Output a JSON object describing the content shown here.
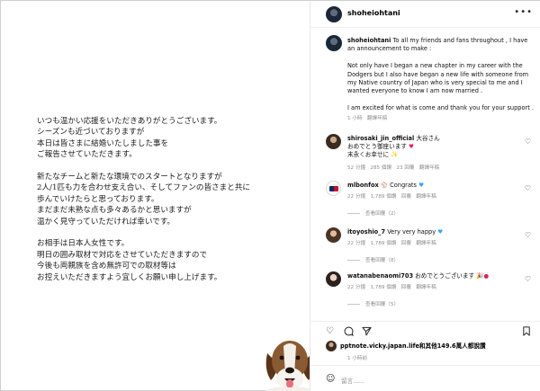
{
  "post": {
    "letter_paragraphs": [
      [
        "いつも温かい応援をいただきありがとうございます。",
        "シーズンも近づいておりますが",
        "本日は皆さまに結婚いたしました事を",
        "ご報告させていただきます。"
      ],
      [
        "新たなチームと新たな環境でのスタートとなりますが",
        "2人/1匹も力を合わせ支え合い、そしてファンの皆さまと共に",
        "歩んでいけたらと思っております。",
        "まだまだ未熟な点も多々あるかと思いますが",
        "温かく見守っていただければ幸いです。"
      ],
      [
        "お相手は日本人女性です。",
        "明日の囲み取材で対応をさせていただきますので",
        "今後も両親族を含め無許可での取材等は",
        "お控えいただきますよう宜しくお願い申し上げます。"
      ]
    ]
  },
  "header": {
    "username": "shoheiohtani",
    "more_icon": "more-horizontal-icon"
  },
  "caption": {
    "username": "shoheiohtani",
    "para1": "To all my friends and fans throughout , I have an announcement to make :",
    "para2": "Not only have I began a new chapter in my career with the Dodgers but I also have began a new life with someone from my Native country of Japan who is very special to me and I wanted everyone to know I am now married .",
    "para3": "I am excited for what is come and thank you for your support .",
    "time": "1 小時",
    "translate": "翻譯年稿"
  },
  "comments": [
    {
      "username": "shirosaki_jin_official",
      "text": "大谷さん おめでとう御座います 末永くお幸せに",
      "text_line1": "大谷さん",
      "text_line2": "おめでとう御座います",
      "text_line3": "末永くお幸せに",
      "time": "52 分鐘",
      "likes": "285 個讚",
      "reply": "23 回覆",
      "translate": "翻譯年稿"
    },
    {
      "username": "mlbonfox",
      "text": "Congrats",
      "time": "22 分鐘",
      "likes": "1,789 個讚",
      "reply": "回覆",
      "translate": "翻譯年稿",
      "view_replies": "查看回覆（2）"
    },
    {
      "username": "itoyoshio_7",
      "text": "Very very happy",
      "time": "22 分鐘",
      "likes": "1,789 個讚",
      "reply": "回覆",
      "translate": "翻譯年稿",
      "view_replies": "查看回覆（8）"
    },
    {
      "username": "watanabenaomi703",
      "text": "おめでとうございます",
      "time": "22 分鐘",
      "likes": "1,789 個讚",
      "reply": "回覆",
      "translate": "翻譯年稿",
      "view_replies": "查看回覆（5）"
    }
  ],
  "actions": {
    "like_icon": "heart-icon",
    "comment_icon": "comment-icon",
    "share_icon": "send-icon",
    "save_icon": "bookmark-icon"
  },
  "likes_line": {
    "text": "pptnote.vicky.japan.life和其他149.6萬人都說讚"
  },
  "posted": "1 小時前",
  "add_comment_placeholder": "留言……"
}
